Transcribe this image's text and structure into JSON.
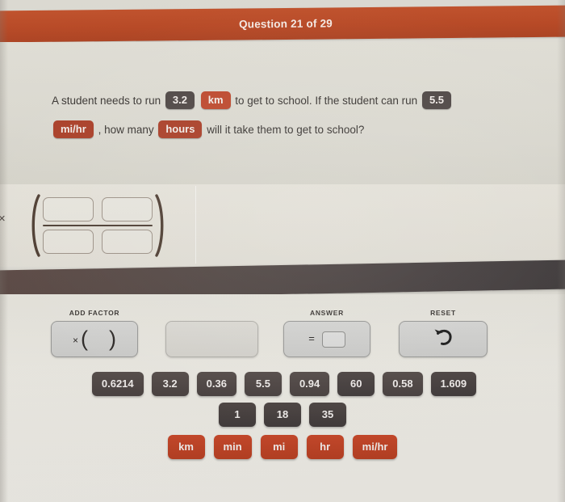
{
  "header": {
    "title": "Question 21 of 29"
  },
  "question": {
    "part1": "A student needs to run",
    "value1": "3.2",
    "unit1": "km",
    "part2": "to get to school. If the student can run",
    "value2": "5.5",
    "unit2": "mi/hr",
    "part3": ", how many",
    "unit3": "hours",
    "part4": "will it take them to get to school?"
  },
  "workspace": {
    "multiply_symbol": "×",
    "open_paren": "(",
    "close_paren": ")",
    "numerator_slots": [
      "",
      ""
    ],
    "denominator_slots": [
      "",
      ""
    ]
  },
  "controls": [
    {
      "label": "ADD FACTOR",
      "name": "add-factor-button",
      "glyph_x": "×",
      "glyph_open": "(",
      "glyph_close": ")"
    },
    {
      "label": "",
      "name": "blank-button"
    },
    {
      "label": "ANSWER",
      "name": "answer-button",
      "glyph_equals": "="
    },
    {
      "label": "RESET",
      "name": "reset-button",
      "icon": "undo-arrow-icon"
    }
  ],
  "tiles": {
    "row1": [
      "0.6214",
      "3.2",
      "0.36",
      "5.5",
      "0.94",
      "60",
      "0.58",
      "1.609"
    ],
    "row2": [
      "1",
      "18",
      "35"
    ],
    "units": [
      "km",
      "min",
      "mi",
      "hr",
      "mi/hr"
    ]
  },
  "colors": {
    "header_bar": "#b5421d",
    "badge_dark": "#4a4240",
    "badge_red": "#bc4327",
    "tile_number": "#4e4644",
    "tile_unit": "#c8482a",
    "dark_band": "#4e4340",
    "page_background": "#dedcd4"
  }
}
